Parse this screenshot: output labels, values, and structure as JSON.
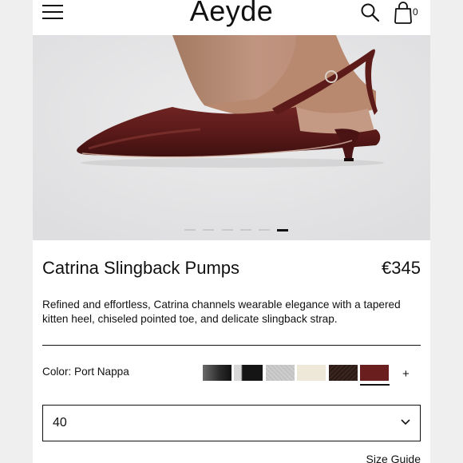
{
  "header": {
    "logo": "Aeyde",
    "bag_count": "0",
    "icons": [
      "menu-icon",
      "search-icon",
      "shopping-bag-icon"
    ]
  },
  "hero": {
    "image": "burgundy-slingback-pump-photo",
    "carousel_slides": 6,
    "carousel_active_index": 5
  },
  "product": {
    "title": "Catrina Slingback Pumps",
    "price": "€345",
    "description": "Refined and effortless, Catrina channels wearable elegance with a tapered kitten heel, chiseled pointed toe, and delicate slingback strap."
  },
  "color": {
    "label": "Color: Port Nappa",
    "swatches": [
      {
        "name": "grey-black",
        "color": "#3a3a3a"
      },
      {
        "name": "black",
        "color": "#151515"
      },
      {
        "name": "light-grey",
        "color": "#c9c9c9"
      },
      {
        "name": "cream",
        "color": "#eee8d8"
      },
      {
        "name": "dark-brown",
        "color": "#3b2720"
      },
      {
        "name": "port",
        "color": "#6b1e1e"
      }
    ],
    "selected_index": 5,
    "more_label": "+"
  },
  "size": {
    "selected": "40"
  },
  "links": {
    "size_guide": "Size Guide"
  }
}
